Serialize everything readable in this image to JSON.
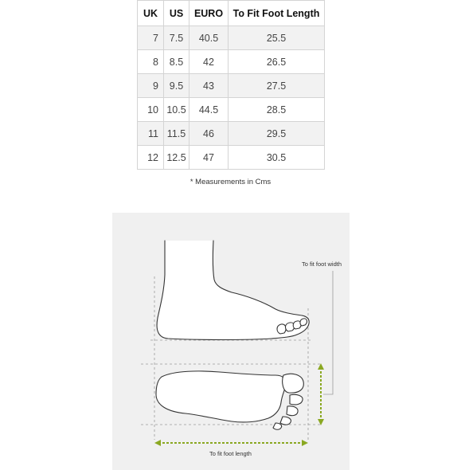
{
  "table": {
    "headers": {
      "uk": "UK",
      "us": "US",
      "euro": "EURO",
      "foot_length": "To Fit Foot Length"
    },
    "rows": [
      {
        "uk": "7",
        "us": "7.5",
        "euro": "40.5",
        "foot_length": "25.5"
      },
      {
        "uk": "8",
        "us": "8.5",
        "euro": "42",
        "foot_length": "26.5"
      },
      {
        "uk": "9",
        "us": "9.5",
        "euro": "43",
        "foot_length": "27.5"
      },
      {
        "uk": "10",
        "us": "10.5",
        "euro": "44.5",
        "foot_length": "28.5"
      },
      {
        "uk": "11",
        "us": "11.5",
        "euro": "46",
        "foot_length": "29.5"
      },
      {
        "uk": "12",
        "us": "12.5",
        "euro": "47",
        "foot_length": "30.5"
      }
    ]
  },
  "note": "* Measurements in Cms",
  "diagram": {
    "width_label": "To fit foot width",
    "length_label": "To fit foot length",
    "arrow_color": "#8aa822",
    "outline_color": "#333333",
    "guide_color": "#9a9a9a"
  }
}
